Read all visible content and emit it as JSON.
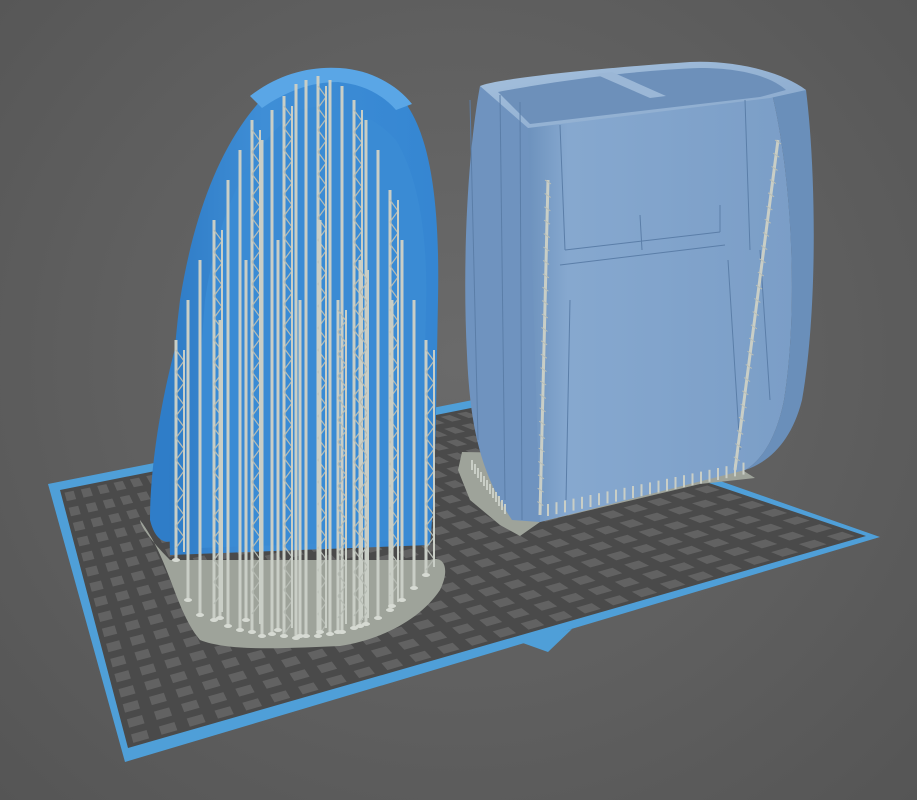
{
  "viewport": {
    "background": "#5e5e5e",
    "build_plate": {
      "surface_color": "#4a4a4a",
      "grid_cell_color": "#626262",
      "border_color": "#4f9fd8",
      "front_notch": "triangle-marker"
    }
  },
  "objects": [
    {
      "id": "part-curved-shell",
      "label_visible": false,
      "state": "selected",
      "color": "#3f8ed6",
      "highlight_color": "#5aa6e6",
      "has_supports": true,
      "support_color": "#c9cec6",
      "raft_color": "#9ea39a"
    },
    {
      "id": "part-box-shell",
      "label_visible": false,
      "state": "unselected",
      "color": "#7ea1c9",
      "highlight_color": "#9cbad9",
      "has_supports": true,
      "support_color": "#c9cec6",
      "raft_color": "#9ea39a"
    }
  ]
}
